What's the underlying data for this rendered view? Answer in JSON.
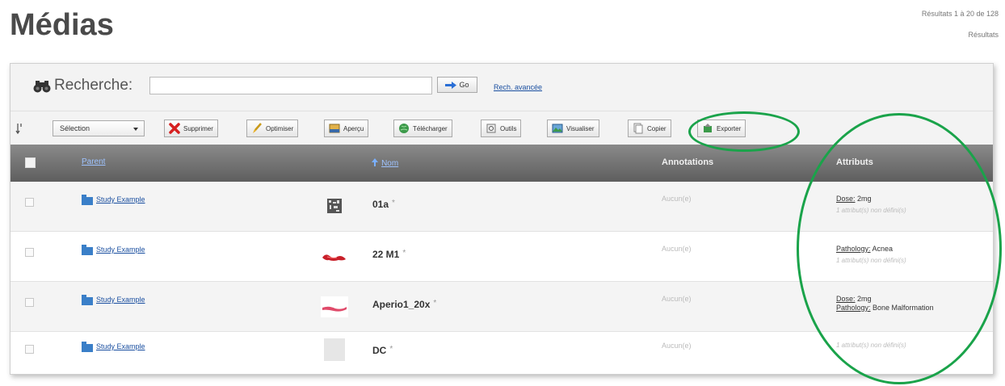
{
  "page": {
    "title": "Médias",
    "results_line_1": "Résultats 1 à 20 de 128",
    "results_line_2": "Résultats"
  },
  "search": {
    "label": "Recherche:",
    "value": "",
    "placeholder": "",
    "go_label": "Go",
    "advanced_label": "Rech. avancée"
  },
  "toolbar": {
    "select_value": "Sélection",
    "buttons": [
      {
        "label": "Supprimer",
        "icon": "delete-x-icon"
      },
      {
        "label": "Optimiser",
        "icon": "brush-icon"
      },
      {
        "label": "Aperçu",
        "icon": "preview-image-icon"
      },
      {
        "label": "Télécharger",
        "icon": "download-globe-icon"
      },
      {
        "label": "Outils",
        "icon": "tools-icon"
      },
      {
        "label": "Visualiser",
        "icon": "view-image-icon"
      },
      {
        "label": "Copier",
        "icon": "copy-icon"
      },
      {
        "label": "Exporter",
        "icon": "export-icon"
      }
    ]
  },
  "table": {
    "headers": {
      "parent": "Parent",
      "nom": "Nom",
      "annotations": "Annotations",
      "attributs": "Attributs"
    },
    "rows": [
      {
        "parent": "Study Example",
        "name": "01a",
        "annotations": "Aucun(e)",
        "attr_line1_key": "Dose:",
        "attr_line1_val": " 2mg",
        "attr_line2_key": "",
        "attr_line2_val": "1 attribut(s) non défini(s)",
        "thumb": "barcode"
      },
      {
        "parent": "Study Example",
        "name": "22 M1",
        "annotations": "Aucun(e)",
        "attr_line1_key": "Pathology:",
        "attr_line1_val": " Acnea",
        "attr_line2_key": "",
        "attr_line2_val": "1 attribut(s) non défini(s)",
        "thumb": "red-tissue"
      },
      {
        "parent": "Study Example",
        "name": "Aperio1_20x",
        "annotations": "Aucun(e)",
        "attr_line1_key": "Dose:",
        "attr_line1_val": " 2mg",
        "attr_line2_key": "Pathology:",
        "attr_line2_val": " Bone Malformation",
        "thumb": "pink-tissue"
      },
      {
        "parent": "Study Example",
        "name": "DC",
        "annotations": "Aucun(e)",
        "attr_line1_key": "",
        "attr_line1_val": "1 attribut(s) non défini(s)",
        "attr_line2_key": "",
        "attr_line2_val": "",
        "thumb": "grey"
      }
    ]
  },
  "colors": {
    "annotation_circle": "#1aa34a",
    "header_bg": "#6e6e6e",
    "link": "#1a4fa0"
  }
}
